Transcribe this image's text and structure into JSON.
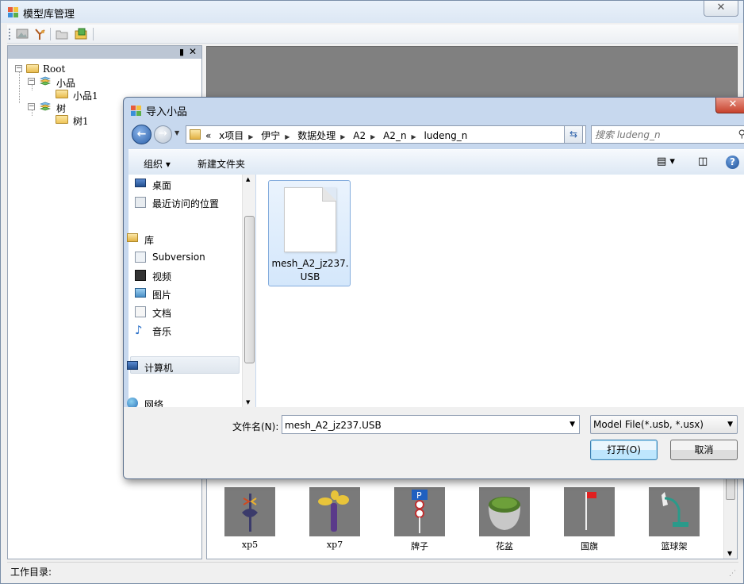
{
  "main_window": {
    "title": "模型库管理",
    "close_symbol": "X"
  },
  "tree": {
    "root": "Root",
    "nodes": [
      {
        "label": "小品",
        "level": 1
      },
      {
        "label": "小品1",
        "level": 2
      },
      {
        "label": "树",
        "level": 1
      },
      {
        "label": "树1",
        "level": 2
      }
    ]
  },
  "panel_icons": {
    "pin": "pin-icon",
    "close": "close-icon"
  },
  "thumbnails": [
    {
      "label": "xp5"
    },
    {
      "label": "xp7"
    },
    {
      "label": "牌子"
    },
    {
      "label": "花盆"
    },
    {
      "label": "国旗"
    },
    {
      "label": "篮球架"
    }
  ],
  "status_bar": {
    "text": "工作目录:"
  },
  "dialog": {
    "title": "导入小品",
    "breadcrumbs": [
      "«",
      "x项目",
      "伊宁",
      "数据处理",
      "A2",
      "A2_n",
      "ludeng_n"
    ],
    "search_placeholder": "搜索 ludeng_n",
    "cmd": {
      "organize": "组织 ▾",
      "new_folder": "新建文件夹"
    },
    "nav": {
      "desktop": "桌面",
      "recent": "最近访问的位置",
      "library": "库",
      "subversion": "Subversion",
      "video": "视频",
      "pictures": "图片",
      "docs": "文档",
      "music": "音乐",
      "computer": "计算机",
      "network": "网络"
    },
    "file": {
      "name": "mesh_A2_jz237.USB"
    },
    "filename_label": "文件名(N):",
    "filename_value": "mesh_A2_jz237.USB",
    "filter": "Model File(*.usb, *.usx)",
    "open_button": "打开(O)",
    "cancel_button": "取消"
  }
}
